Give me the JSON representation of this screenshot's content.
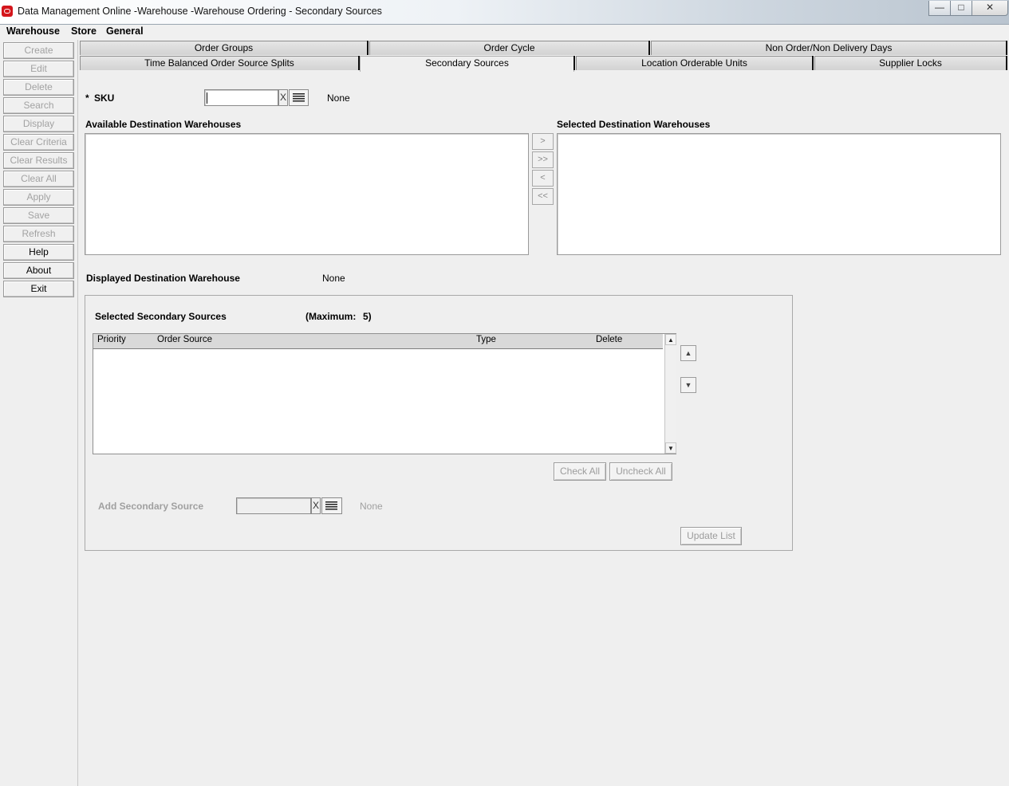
{
  "window": {
    "title": "Data Management Online -Warehouse -Warehouse Ordering - Secondary Sources",
    "minimize": "—",
    "maximize": "□",
    "close": "✕"
  },
  "menu": {
    "warehouse": "Warehouse",
    "store": "Store",
    "general": "General"
  },
  "toolbar": {
    "create": "Create",
    "edit": "Edit",
    "delete": "Delete",
    "search": "Search",
    "display": "Display",
    "clear_criteria": "Clear Criteria",
    "clear_results": "Clear Results",
    "clear_all": "Clear All",
    "apply": "Apply",
    "save": "Save",
    "refresh": "Refresh",
    "help": "Help",
    "about": "About",
    "exit": "Exit"
  },
  "tabs": {
    "order_groups": "Order Groups",
    "order_cycle": "Order Cycle",
    "non_order_days": "Non Order/Non Delivery Days",
    "time_balanced": "Time Balanced Order Source Splits",
    "secondary_sources": "Secondary Sources",
    "location_orderable_units": "Location Orderable Units",
    "supplier_locks": "Supplier Locks",
    "active_tab": "Secondary Sources"
  },
  "form": {
    "sku_required_marker": "*",
    "sku_label": "SKU",
    "sku_value": "",
    "sku_clear": "X",
    "sku_description": "None",
    "available_label": "Available Destination Warehouses",
    "selected_label": "Selected Destination Warehouses",
    "move_right": ">",
    "move_all_right": ">>",
    "move_left": "<",
    "move_all_left": "<<",
    "displayed_label": "Displayed Destination Warehouse",
    "displayed_value": "None"
  },
  "secondary_panel": {
    "title": "Selected Secondary Sources",
    "maximum_label": "(Maximum:",
    "maximum_value": "5)",
    "columns": {
      "priority": "Priority",
      "order_source": "Order Source",
      "type": "Type",
      "delete": "Delete"
    },
    "rows": [],
    "check_all": "Check All",
    "uncheck_all": "Uncheck All",
    "add_label": "Add Secondary Source",
    "add_value": "",
    "add_clear": "X",
    "add_description": "None",
    "update_list": "Update List"
  }
}
